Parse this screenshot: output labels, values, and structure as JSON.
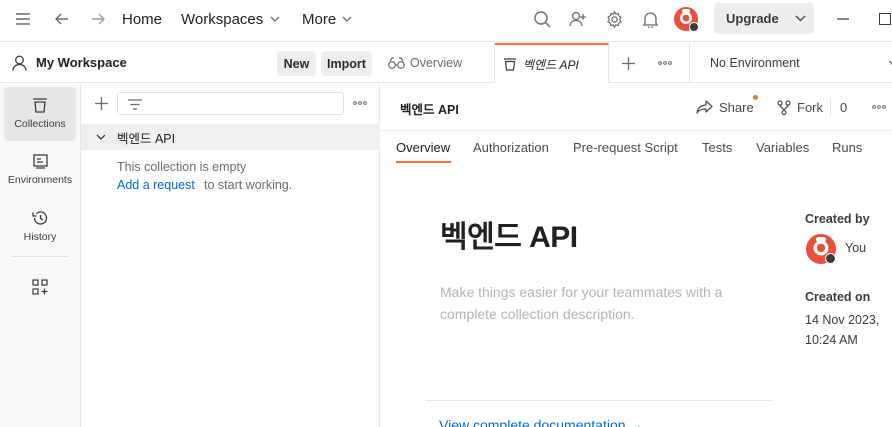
{
  "topbar": {
    "home": "Home",
    "workspaces": "Workspaces",
    "more": "More",
    "upgrade": "Upgrade"
  },
  "workspace": {
    "name": "My Workspace",
    "new_label": "New",
    "import_label": "Import"
  },
  "rail": [
    {
      "label": "Collections",
      "icon": "collections-icon",
      "active": true
    },
    {
      "label": "Environments",
      "icon": "environments-icon",
      "active": false
    },
    {
      "label": "History",
      "icon": "history-icon",
      "active": false
    }
  ],
  "sidebar": {
    "collection_name": "벡엔드 API",
    "empty_line1": "This collection is empty",
    "add_request_link": "Add a request",
    "empty_line2_suffix": "to start working."
  },
  "tabs": {
    "overview": "Overview",
    "collection": "벡엔드 API",
    "environment": "No Environment"
  },
  "collection": {
    "name": "벡엔드 API",
    "share": "Share",
    "fork": "Fork",
    "fork_count": "0",
    "subtabs": [
      "Overview",
      "Authorization",
      "Pre-request Script",
      "Tests",
      "Variables",
      "Runs"
    ],
    "title": "벡엔드 API",
    "description_placeholder": "Make things easier for your teammates with a complete collection description.",
    "created_by_label": "Created by",
    "created_by": "You",
    "created_on_label": "Created on",
    "created_on_date": "14 Nov 2023,",
    "created_on_time": "10:24 AM",
    "doc_link": "View complete documentation →"
  },
  "colors": {
    "accent": "#ff6c37",
    "link": "#0265d2",
    "avatar": "#e8503a"
  }
}
